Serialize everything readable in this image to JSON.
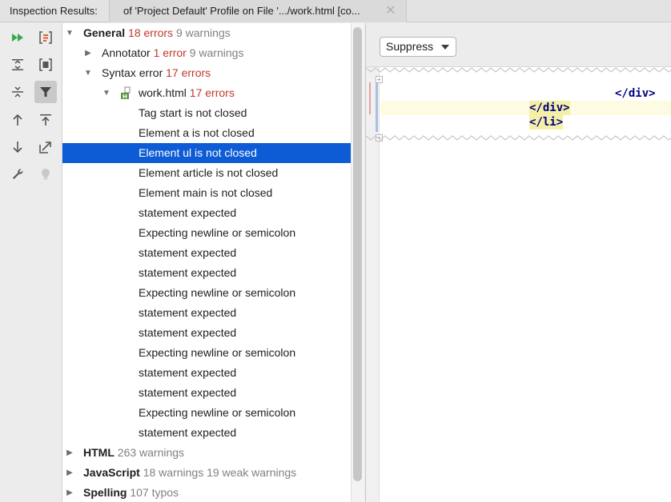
{
  "tabbar": {
    "title": "Inspection Results:",
    "tab_label": "of 'Project Default' Profile on File '.../work.html [co...",
    "close_glyph": "✕"
  },
  "toolbar": {
    "buttons": [
      "rerun-icon",
      "export-icon",
      "expand-all-icon",
      "autoscroll-icon",
      "collapse-all-icon",
      "filter-icon",
      "previous-icon",
      "jump-up-icon",
      "next-icon",
      "open-source-icon",
      "settings-wrench-icon",
      "quickfix-bulb-icon"
    ]
  },
  "tree": {
    "general": {
      "name": "General",
      "errors": "18 errors",
      "warnings": "9 warnings"
    },
    "annotator": {
      "name": "Annotator",
      "errors": "1 error",
      "warnings": "9 warnings"
    },
    "syntax": {
      "name": "Syntax error",
      "errors": "17 errors"
    },
    "file": {
      "name": "work.html",
      "errors": "17 errors"
    },
    "problems": [
      "Tag start is not closed",
      "Element a is not closed",
      "Element ul is not closed",
      "Element article is not closed",
      "Element main is not closed",
      "statement expected",
      "Expecting newline or semicolon",
      "statement expected",
      "statement expected",
      "Expecting newline or semicolon",
      "statement expected",
      "statement expected",
      "Expecting newline or semicolon",
      "statement expected",
      "statement expected",
      "Expecting newline or semicolon",
      "statement expected"
    ],
    "html": {
      "name": "HTML",
      "warnings": "263 warnings"
    },
    "javascript": {
      "name": "JavaScript",
      "warnings": "18 warnings 19 weak warnings"
    },
    "spelling": {
      "name": "Spelling",
      "warnings": "107 typos"
    }
  },
  "preview": {
    "suppress_label": "Suppress",
    "code_lines": [
      "</div>",
      "</div>",
      "</li>"
    ]
  },
  "colors": {
    "selection": "#0d5cd5",
    "error": "#c0392b",
    "warning": "#808080"
  }
}
